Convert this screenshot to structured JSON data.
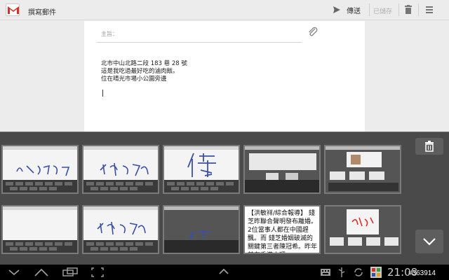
{
  "header": {
    "title": "撰寫郵件",
    "send_label": "傳送",
    "saved_label": "已儲存",
    "icons": [
      "gmail-icon",
      "send-icon",
      "trash-icon",
      "overflow-menu-icon"
    ]
  },
  "compose": {
    "subject_label": "主旨：",
    "body_lines": [
      "北市中山北路二段 183 巷 28 號",
      "這是我吃過最好吃的滷肉飯。",
      "位在晴光市場小公園旁邊"
    ]
  },
  "handwriting_panel": {
    "thumbnails": [
      {
        "kind": "handwriting",
        "ink": "小公園旁邊"
      },
      {
        "kind": "handwriting",
        "ink": "晴光市場"
      },
      {
        "kind": "handwriting",
        "ink": "傳"
      },
      {
        "kind": "screenshot"
      },
      {
        "kind": "screenshot"
      },
      {
        "kind": "handwriting"
      },
      {
        "kind": "handwriting",
        "ink": "晴光市場"
      },
      {
        "kind": "handwriting",
        "ink": "傳"
      },
      {
        "kind": "news",
        "text": "【洪敏祥/綜合報導】 錢芝昨聯合聲明發布離婚。2位當事人都在中國趕飄。而 錢芝婚姻破滅的關鍵第三者陳冠希。昨年前在香港中環"
      },
      {
        "kind": "screenshot",
        "ink": "到此一遊"
      }
    ]
  },
  "system_bar": {
    "clock": "21:08",
    "watermark": "#363914"
  },
  "colors": {
    "ink_blue": "#3b4fa8",
    "panel_bg": "#4a4a4a",
    "gmail_red": "#d93025"
  }
}
